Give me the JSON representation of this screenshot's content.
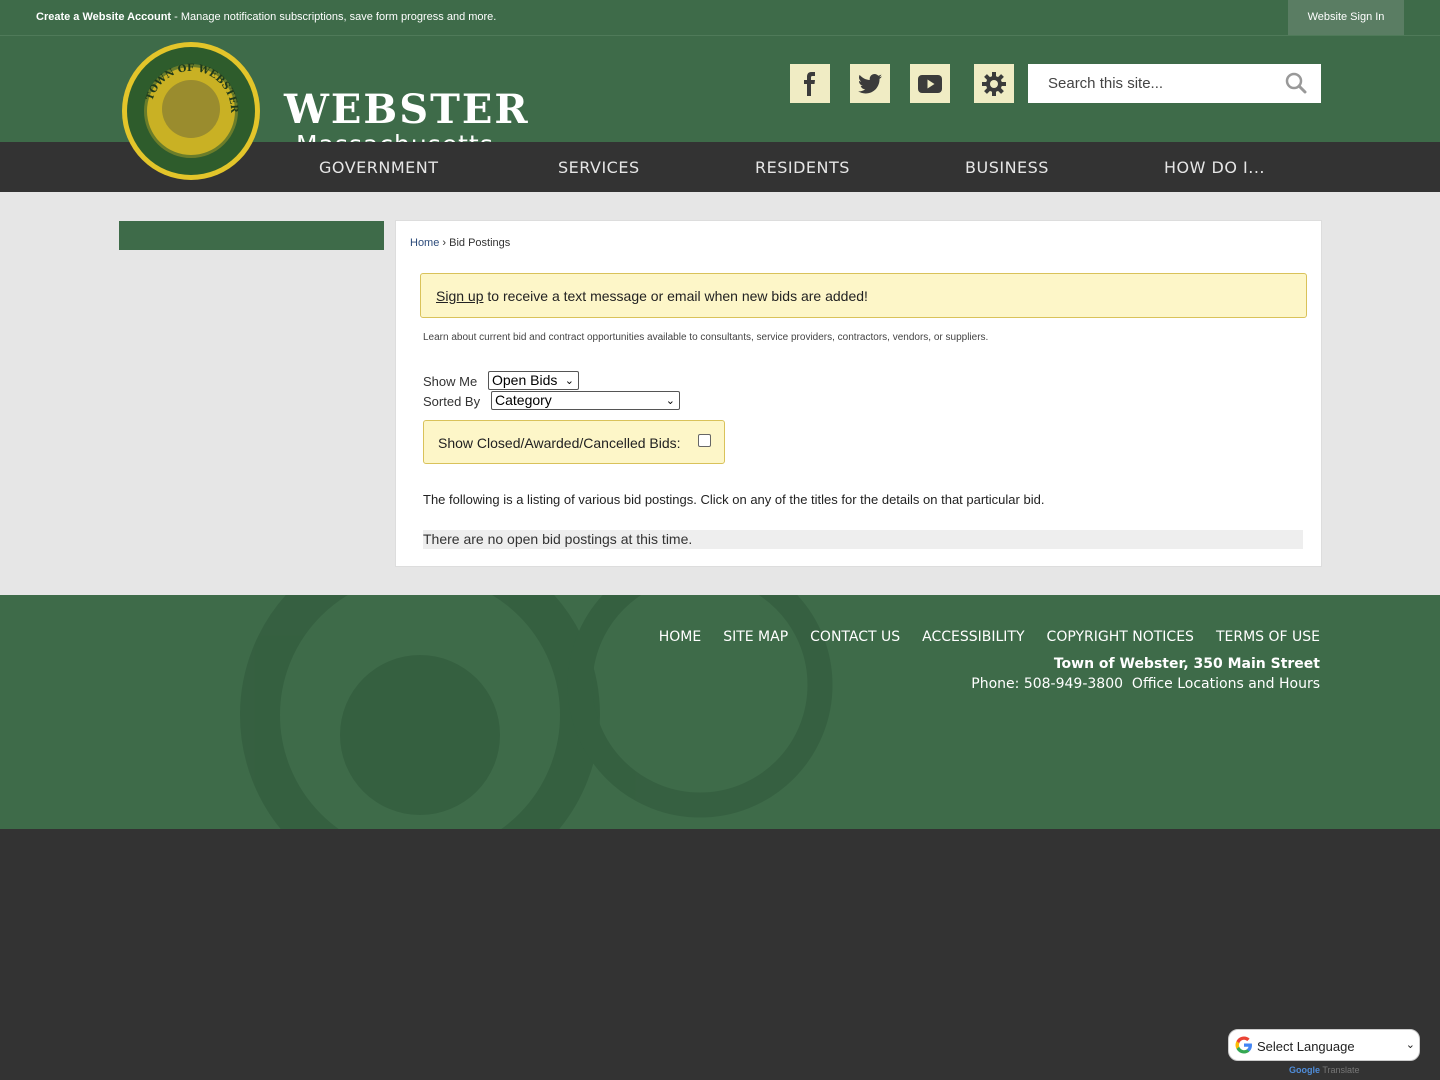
{
  "topbar": {
    "create_account_label": "Create a Website Account",
    "create_account_desc": " - Manage notification subscriptions, save form progress and more.",
    "sign_in_label": "Website Sign In"
  },
  "header": {
    "title": "WEBSTER",
    "subtitle": "Massachusetts",
    "seal_text": "TOWN OF WEBSTER",
    "social": [
      "facebook-icon",
      "twitter-icon",
      "youtube-icon",
      "gear-icon"
    ],
    "search_placeholder": "Search this site..."
  },
  "nav": {
    "items": [
      {
        "label": "GOVERNMENT"
      },
      {
        "label": "SERVICES"
      },
      {
        "label": "RESIDENTS"
      },
      {
        "label": "BUSINESS"
      },
      {
        "label": "HOW DO I..."
      }
    ]
  },
  "main": {
    "breadcrumb": {
      "home": "Home",
      "sep": " › ",
      "current": "Bid Postings"
    },
    "alert": {
      "link": "Sign up",
      "text": " to receive a text message or email when new bids are added!"
    },
    "intro": "Learn about current bid and contract opportunities available to consultants, service providers, contractors, vendors, or suppliers.",
    "show_me_label": "Show Me",
    "show_me_value": "Open Bids",
    "sorted_by_label": "Sorted By",
    "sorted_by_value": "Category",
    "closed_label": "Show Closed/Awarded/Cancelled Bids:",
    "closed_checked": false,
    "listing_text": "The following is a listing of various bid postings. Click on any of the titles for the details on that particular bid.",
    "no_posts": "There are no open bid postings at this time."
  },
  "footer": {
    "links": [
      "HOME",
      "SITE MAP",
      "CONTACT US",
      "ACCESSIBILITY",
      "COPYRIGHT NOTICES",
      "TERMS OF USE"
    ],
    "address": "Town of Webster, 350 Main Street",
    "phone": "Phone: 508-949-3800",
    "office_link": "Office Locations and Hours"
  },
  "translate": {
    "label": "Select Language",
    "powered_brand": "Google",
    "powered_text": " Translate"
  },
  "colors": {
    "brand_green": "#3e6b49",
    "nav_dark": "#333333",
    "alert_bg": "#fdf6c8"
  }
}
